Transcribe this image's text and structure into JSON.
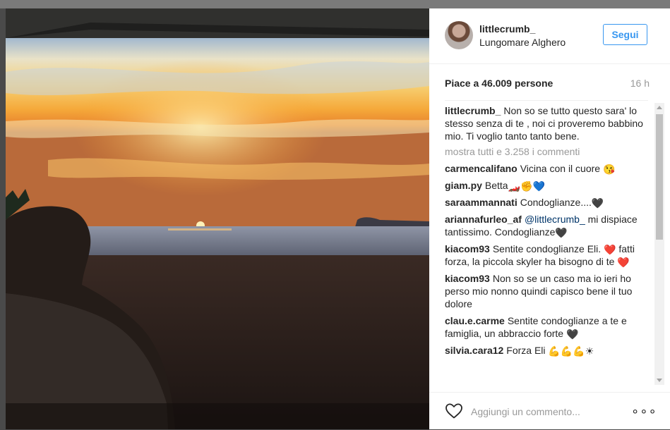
{
  "post": {
    "username": "littlecrumb_",
    "location": "Lungomare Alghero",
    "follow_label": "Segui",
    "likes": "Piace a 46.009 persone",
    "time": "16 h",
    "caption": "Non so se tutto questo sara' lo stesso senza di te , noi ci proveremo babbino mio. Ti voglio tanto tanto bene.",
    "show_all": "mostra tutti e 3.258 i commenti"
  },
  "comments": [
    {
      "user": "carmencalifano",
      "text": "Vicina con il cuore",
      "emoji": "😘"
    },
    {
      "user": "giam.py",
      "text": "Betta",
      "emoji": "🏎️✊💙"
    },
    {
      "user": "saraammannati",
      "text": "Condoglianze....",
      "emoji": "🖤"
    },
    {
      "user": "ariannafurleo_af",
      "mention": "@littlecrumb_",
      "text": "mi dispiace tantissimo. Condoglianze",
      "emoji": "🖤"
    },
    {
      "user": "kiacom93",
      "text": "Sentite condoglianze Eli.",
      "emoji": "❤️",
      "text2": "fatti forza, la piccola skyler ha bisogno di te",
      "emoji2": "❤️"
    },
    {
      "user": "kiacom93",
      "text": "Non so se un caso ma io ieri ho perso mio nonno quindi capisco bene il tuo dolore"
    },
    {
      "user": "clau.e.carme",
      "text": "Sentite condoglianze a te e famiglia, un abbraccio forte",
      "emoji": "🖤"
    },
    {
      "user": "silvia.cara12",
      "text": "Forza Eli",
      "emoji": "💪💪💪☀"
    }
  ],
  "comment_box": {
    "placeholder": "Aggiungi un commento..."
  },
  "icons": {
    "like": "heart-outline-icon",
    "options": "more-options-icon"
  },
  "colors": {
    "accent": "#3897f0",
    "muted": "#999999",
    "text": "#262626"
  }
}
